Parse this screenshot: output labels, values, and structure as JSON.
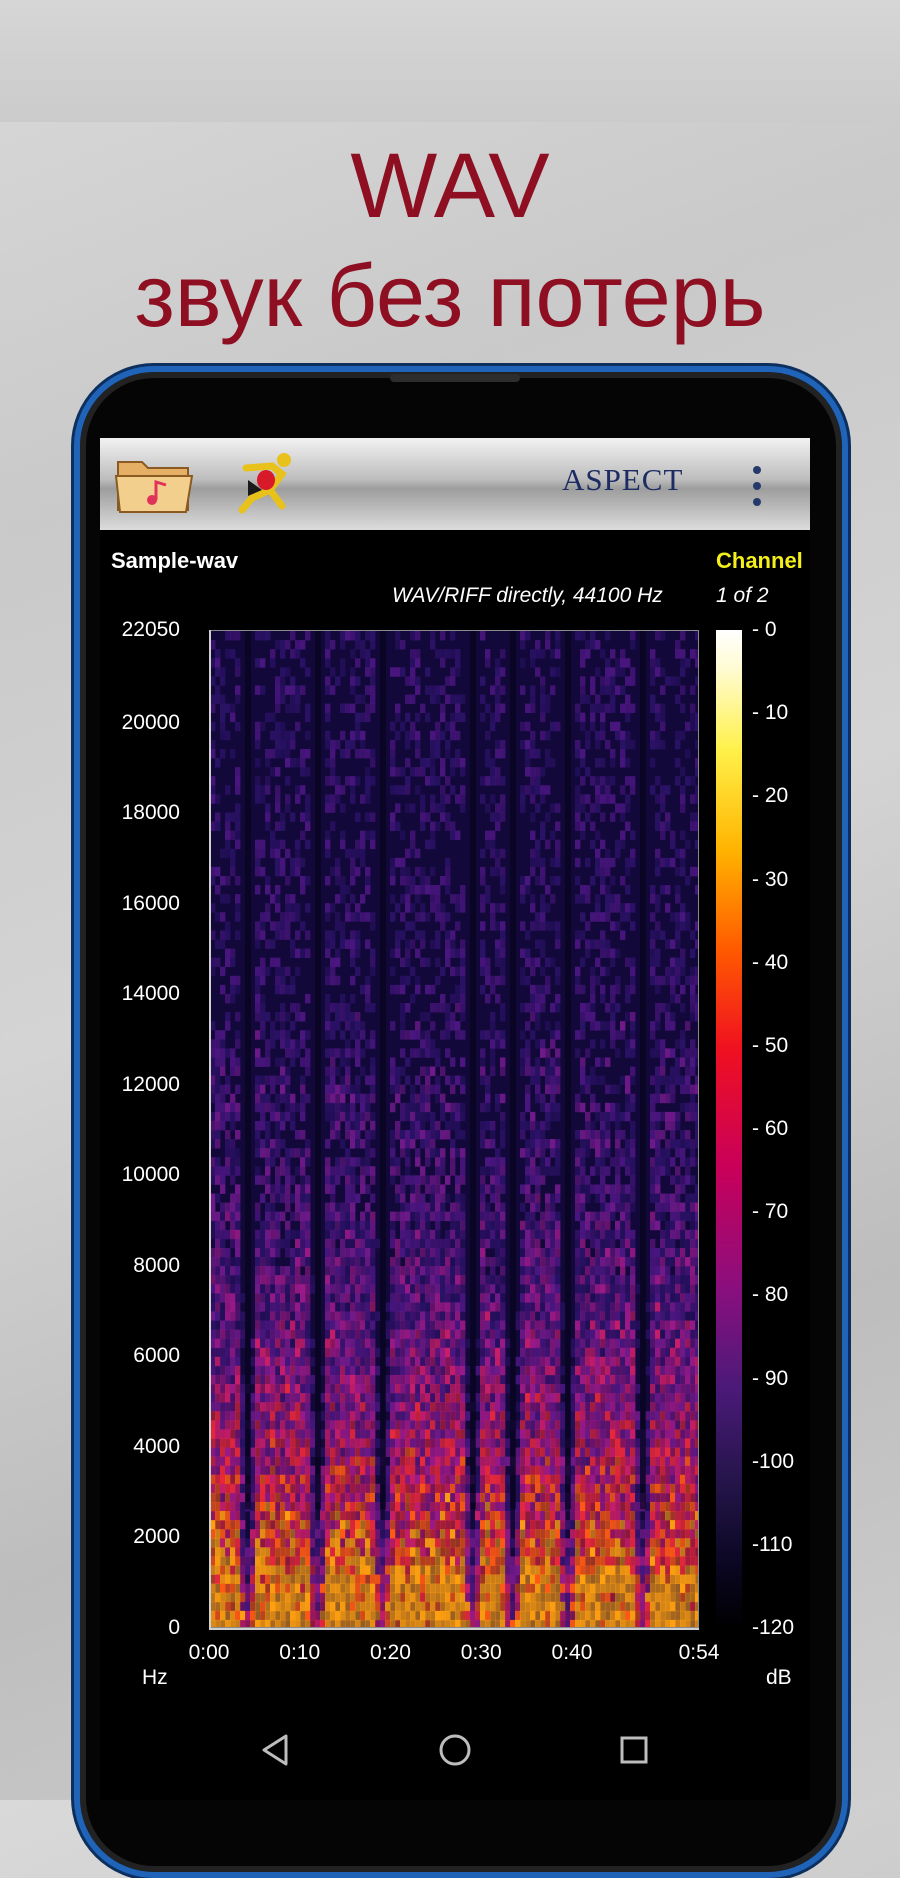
{
  "promo": {
    "line1": "WAV",
    "line2": "звук без потерь"
  },
  "toolbar": {
    "brand": "ASPECT",
    "icons": [
      "music-folder-icon",
      "running-figure-icon",
      "overflow-menu-icon"
    ]
  },
  "recording": {
    "title": "Sample-wav",
    "format": "WAV/RIFF directly, 44100 Hz",
    "channel_label": "Channel",
    "channel_count": "1 of 2"
  },
  "colors": {
    "headline": "#8e0f22",
    "channel_label": "#f4ee1a",
    "brand": "#1d2d63",
    "phone_frame": "#1f64b8"
  },
  "chart_data": {
    "type": "heatmap",
    "title": "Sample-wav",
    "xlabel": "",
    "ylabel": "Hz",
    "x_ticks": [
      "0:00",
      "0:10",
      "0:20",
      "0:30",
      "0:40",
      "0:54"
    ],
    "x_tick_values": [
      0,
      10,
      20,
      30,
      40,
      54
    ],
    "xlim": [
      0,
      54
    ],
    "y_ticks": [
      "0",
      "2000",
      "4000",
      "6000",
      "8000",
      "10000",
      "12000",
      "14000",
      "16000",
      "18000",
      "20000",
      "22050"
    ],
    "y_tick_values": [
      0,
      2000,
      4000,
      6000,
      8000,
      10000,
      12000,
      14000,
      16000,
      18000,
      20000,
      22050
    ],
    "ylim": [
      0,
      22050
    ],
    "y_unit": "Hz",
    "colorbar_label": "dB",
    "colorbar_ticks": [
      "- 0",
      "- 10",
      "- 20",
      "- 30",
      "- 40",
      "- 50",
      "- 60",
      "- 70",
      "- 80",
      "- 90",
      "-100",
      "-110",
      "-120"
    ],
    "colorbar_values": [
      0,
      -10,
      -20,
      -30,
      -40,
      -50,
      -60,
      -70,
      -80,
      -90,
      -100,
      -110,
      -120
    ],
    "colorbar_range": [
      -120,
      0
    ],
    "colormap": "inferno-like (black - purple - red - yellow - white)"
  },
  "navigation": {
    "buttons": [
      "back-icon",
      "home-icon",
      "recents-icon"
    ]
  }
}
